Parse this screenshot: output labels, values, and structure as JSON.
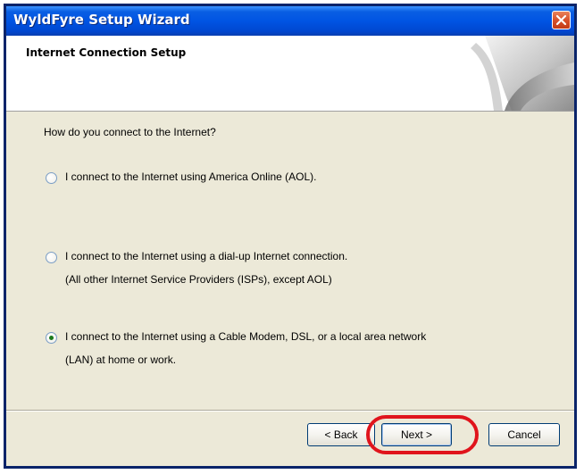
{
  "window": {
    "title": "WyldFyre Setup Wizard"
  },
  "header": {
    "heading": "Internet Connection Setup"
  },
  "content": {
    "question": "How do you connect to the Internet?",
    "options": [
      {
        "line1": "I connect to the Internet using America Online (AOL).",
        "line2": "",
        "selected": false
      },
      {
        "line1": "I connect to the Internet using a dial-up Internet connection.",
        "line2": "(All other Internet Service Providers (ISPs), except AOL)",
        "selected": false
      },
      {
        "line1": "I connect to the Internet using a Cable Modem, DSL, or a local area network",
        "line2": "(LAN) at home or work.",
        "selected": true
      }
    ]
  },
  "buttons": {
    "back": "< Back",
    "next": "Next >",
    "cancel": "Cancel"
  },
  "colors": {
    "titlebar": "#0054e3",
    "close_button": "#d8512b",
    "annotation_ring": "#e0141c",
    "selected_radio": "#1c7a1c"
  },
  "icons": {
    "close": "close-x-icon",
    "header": "page-curl-graphic"
  }
}
